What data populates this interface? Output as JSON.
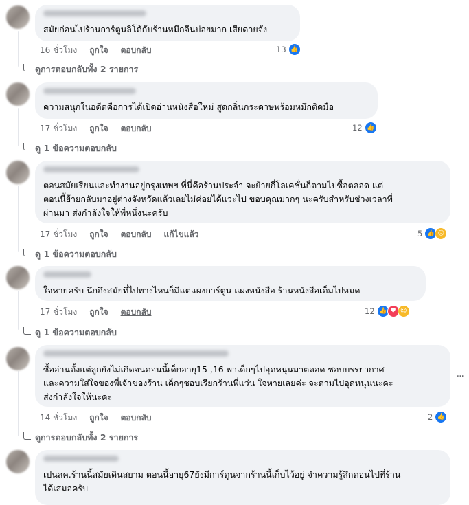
{
  "comments": [
    {
      "text": "สมัยก่อนไปร้านการ์ตูนลิโด้กับร้านหมึกจีนบ่อยมาก เสียดายจัง",
      "time": "16 ชั่วโมง",
      "like_label": "ถูกใจ",
      "reply_label": "ตอบกลับ",
      "reaction_count": "13",
      "reactions": [
        "like-icon"
      ],
      "replies_label": "ดูการตอบกลับทั้ง 2 รายการ"
    },
    {
      "text": "ความสนุกในอดีตคือการได้เปิดอ่านหนังสือใหม่ สูดกลิ่นกระดาษพร้อมหมึกติดมือ",
      "time": "17 ชั่วโมง",
      "like_label": "ถูกใจ",
      "reply_label": "ตอบกลับ",
      "reaction_count": "12",
      "reactions": [
        "like-icon"
      ],
      "replies_label": "ดู 1 ข้อความตอบกลับ"
    },
    {
      "text": "ตอนสมัยเรียนและทำงานอยู่กรุงเทพฯ ที่นี่คือร้านประจำ จะย้ายกี่โลเคชั่นก็ตามไปซื้อตลอด แต่\nตอนนี้ย้ายกลับมาอยู่ต่างจังหวัดแล้วเลยไม่ค่อยได้แวะไป ขอบคุณมากๆ นะครับสำหรับช่วงเวลาที่\nผ่านมา ส่งกำลังใจให้พี่หนึ่งนะครับ",
      "time": "17 ชั่วโมง",
      "like_label": "ถูกใจ",
      "reply_label": "ตอบกลับ",
      "edited_label": "แก้ไขแล้ว",
      "reaction_count": "5",
      "reactions": [
        "like-icon",
        "sad-icon"
      ],
      "replies_label": "ดู 1 ข้อความตอบกลับ"
    },
    {
      "text": "ใจหายครับ นึกถึงสมัยที่ไปทางไหนก็มีแต่แผงการ์ตูน แผงหนังสือ ร้านหนังสือเต็มไปหมด",
      "time": "17 ชั่วโมง",
      "like_label": "ถูกใจ",
      "reply_label": "ตอบกลับ",
      "reaction_count": "12",
      "reactions": [
        "like-icon",
        "love-icon",
        "care-icon"
      ],
      "replies_label": "ดู 1 ข้อความตอบกลับ"
    },
    {
      "text": "ซื้ออ่านตั้งแต่ลูกยังไม่เกิดจนตอนนี้เด็กอายุ15 ,16 พาเด็กๆไปอุดหนุนมาตลอด ชอบบรรยากาศ\nและความใส่ใจของพี่เจ้าของร้าน เด็กๆชอบเรียกร้านพี่แว่น ใจหายเลยค่ะ จะตามไปอุดหนุนนะคะ\nส่งกำลังใจให้นะคะ",
      "time": "14 ชั่วโมง",
      "like_label": "ถูกใจ",
      "reply_label": "ตอบกลับ",
      "reaction_count": "2",
      "reactions": [
        "like-icon"
      ],
      "replies_label": "ดูการตอบกลับทั้ง 2 รายการ"
    },
    {
      "text": "เปนลค.ร้านนี้สมัยเดินสยาม ตอนนี้อายุ67ยังมีการ์ตูนจากร้านนี้เก็บไว้อยู่ จำความรู้สึกตอนไปที่ร้าน\nได้เสมอครับ"
    }
  ],
  "more_options": "···"
}
